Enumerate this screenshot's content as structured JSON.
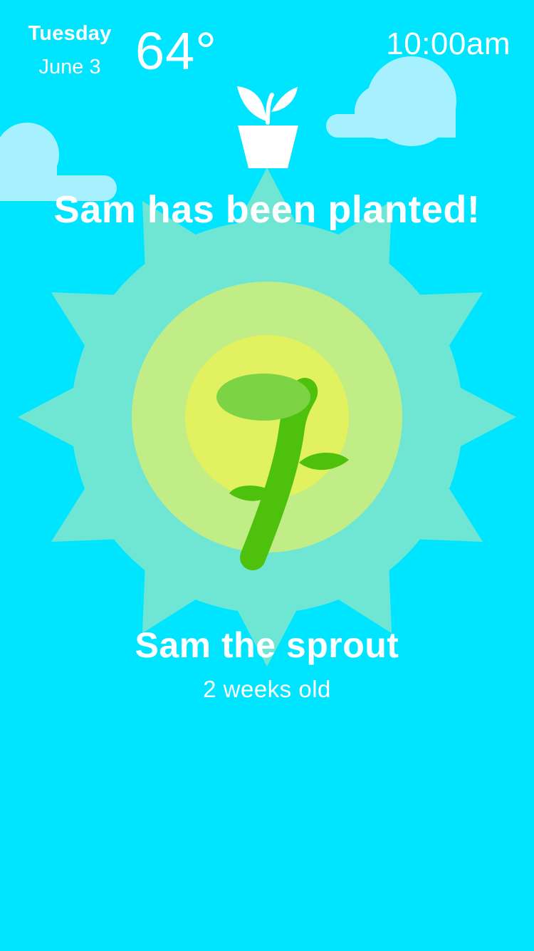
{
  "header": {
    "day": "Tuesday",
    "date": "June 3",
    "temperature": "64°",
    "time": "10:00am"
  },
  "planted_message": "Sam has been planted!",
  "plant": {
    "name": "Sam the sprout",
    "age": "2 weeks old"
  },
  "icons": {
    "pot": "potted-plant-icon",
    "sprout": "sprout-illustration",
    "clouds": "cloud-icon",
    "sun": "sunburst-icon"
  },
  "colors": {
    "background": "#00e5ff",
    "cloud": "#a7f1ff",
    "sun_outer": "#6ee6d3",
    "sun_middle": "#c0ed86",
    "sun_inner": "#e1f160",
    "stem": "#4ec10c",
    "sprout_leaf": "#7cd344",
    "text": "#ffffff"
  }
}
